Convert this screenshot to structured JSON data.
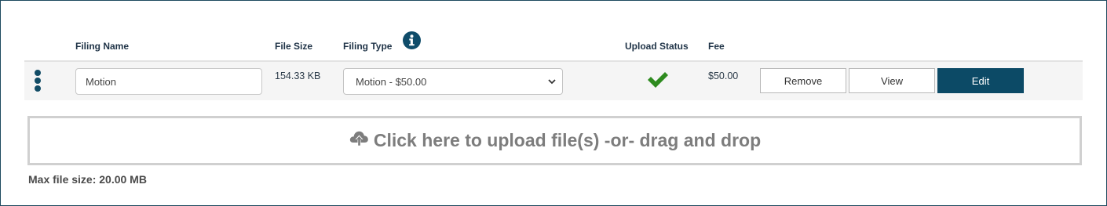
{
  "table": {
    "headers": {
      "filing_name": "Filing Name",
      "file_size": "File Size",
      "filing_type": "Filing Type",
      "upload_status": "Upload Status",
      "fee": "Fee"
    },
    "info_icon": "info-circle-icon",
    "rows": [
      {
        "filing_name_value": "Motion",
        "file_size": "154.33 KB",
        "filing_type_selected": "Motion - $50.00",
        "upload_status_icon": "checkmark-icon",
        "fee": "$50.00",
        "actions": {
          "remove": "Remove",
          "view": "View",
          "edit": "Edit"
        }
      }
    ]
  },
  "upload": {
    "icon": "cloud-upload-icon",
    "label": "Click here to upload file(s) -or- drag and drop"
  },
  "max_file_size": "Max file size: 20.00 MB",
  "colors": {
    "primary": "#0c4a66",
    "success": "#2e8b1f",
    "border": "#1e4a5f"
  }
}
